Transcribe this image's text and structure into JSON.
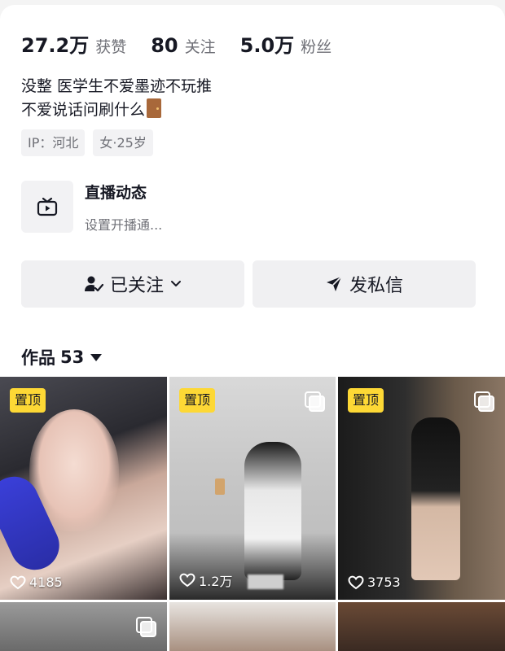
{
  "stats": [
    {
      "value": "27.2万",
      "label": "获赞"
    },
    {
      "value": "80",
      "label": "关注"
    },
    {
      "value": "5.0万",
      "label": "粉丝"
    }
  ],
  "bio": {
    "line1": "没整 医学生不爱墨迹不玩推",
    "line2": "不爱说话问刷什么",
    "line2_icon": "door-icon"
  },
  "tags": [
    "IP：河北",
    "女·25岁"
  ],
  "live": {
    "icon": "tv-play-icon",
    "title": "直播动态",
    "subtitle": "设置开播通..."
  },
  "actions": {
    "follow_label": "已关注",
    "message_label": "发私信"
  },
  "works": {
    "label": "作品",
    "count": "53"
  },
  "grid": [
    {
      "pinned": true,
      "pin_label": "置顶",
      "multi": false,
      "likes": "4185"
    },
    {
      "pinned": true,
      "pin_label": "置顶",
      "multi": true,
      "likes": "1.2万"
    },
    {
      "pinned": true,
      "pin_label": "置顶",
      "multi": true,
      "likes": "3753"
    },
    {
      "pinned": false,
      "multi": true
    },
    {
      "pinned": false,
      "multi": false
    },
    {
      "pinned": false,
      "multi": false
    }
  ],
  "colors": {
    "pin_bg": "#fdd835",
    "text_primary": "#161823",
    "text_secondary": "#6f7077",
    "button_bg": "#f0f0f2"
  }
}
